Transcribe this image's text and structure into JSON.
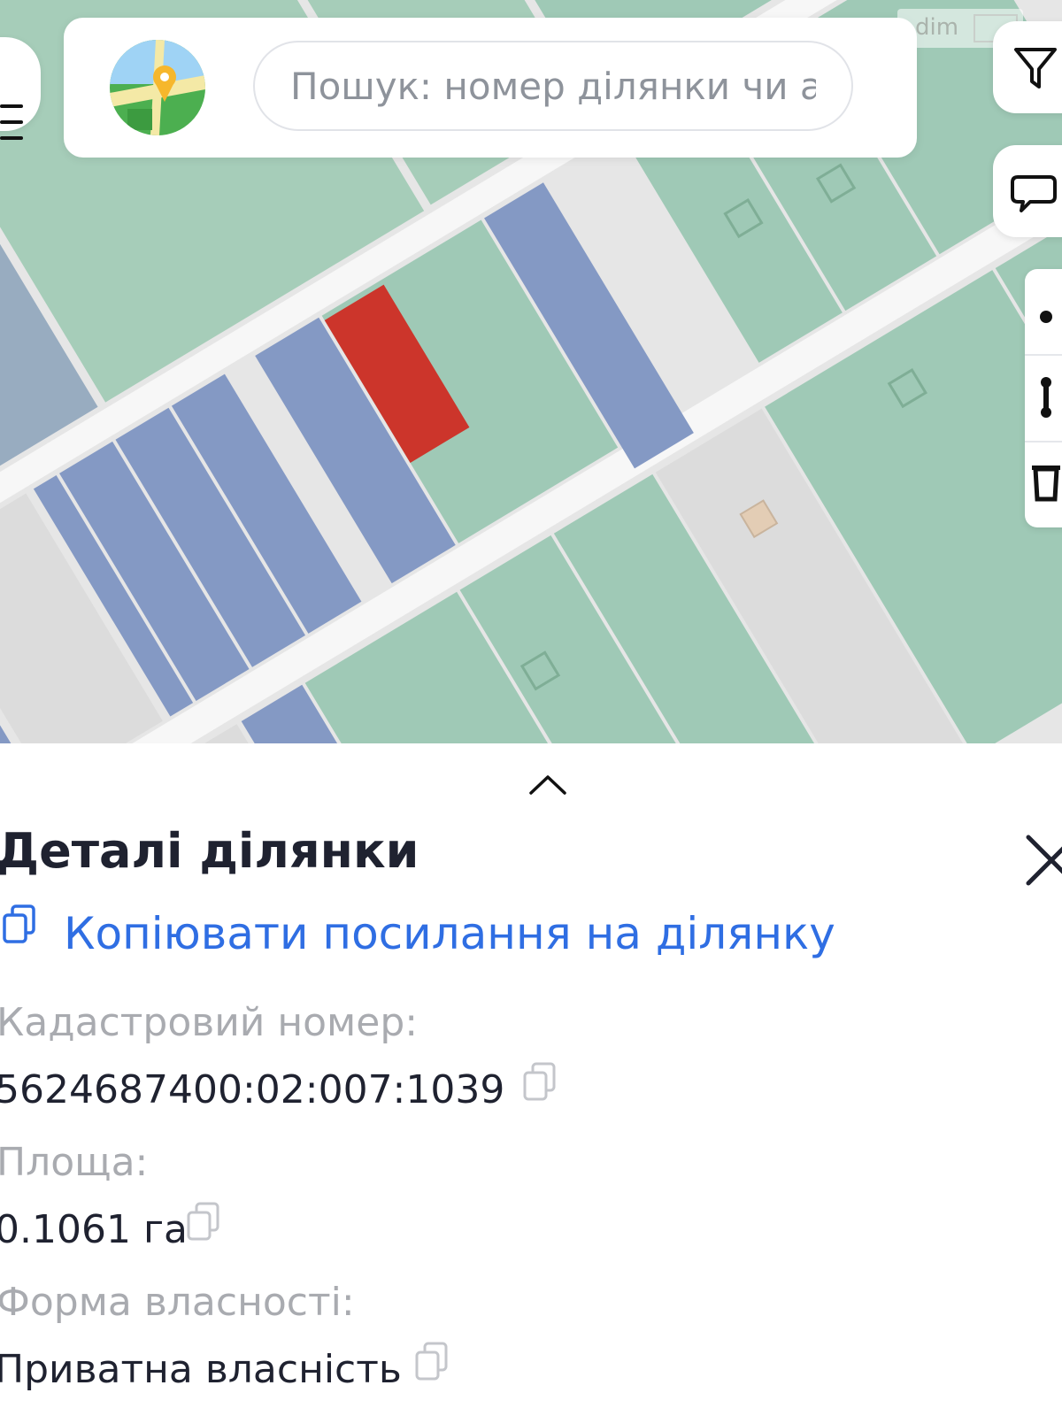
{
  "search": {
    "placeholder": "Пошук: номер ділянки чи адреса"
  },
  "watermark": {
    "text": "dim"
  },
  "details": {
    "title": "Деталі ділянки",
    "copy_link_label": "Копіювати посилання на ділянку",
    "fields": [
      {
        "label": "Кадастровий номер:",
        "value": "5624687400:02:007:1039"
      },
      {
        "label": "Площа:",
        "value": "0.1061 га"
      },
      {
        "label": "Форма власності:",
        "value": "Приватна власність"
      }
    ]
  },
  "colors": {
    "parcel_green": "#9fc9b6",
    "parcel_blue": "#8499c4",
    "selected_parcel": "#cc352b",
    "road": "#e7e7e7",
    "link": "#2f6ee3"
  },
  "icons": [
    "menu-icon",
    "map-logo-icon",
    "filter-icon",
    "comment-icon",
    "measure-point-icon",
    "measure-distance-icon",
    "delete-icon",
    "chevron-up-icon",
    "close-icon",
    "copy-icon"
  ]
}
